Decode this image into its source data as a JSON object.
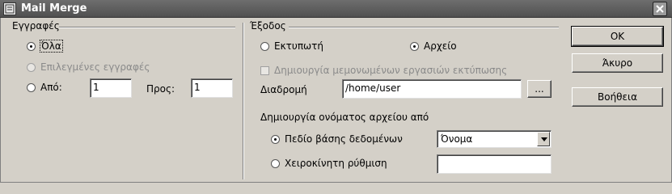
{
  "window": {
    "title": "Mail Merge"
  },
  "records": {
    "group_label": "Εγγραφές",
    "all_label": "Όλα",
    "selected_label": "Επιλεγμένες εγγραφές",
    "from_label": "Από:",
    "from_value": "1",
    "to_label": "Προς:",
    "to_value": "1"
  },
  "output": {
    "group_label": "Έξοδος",
    "printer_label": "Εκτυπωτή",
    "file_label": "Αρχείο",
    "single_jobs_label": "Δημιουργία μεμονωμένων εργασιών εκτύπωσης",
    "path_label": "Διαδρομή",
    "path_value": "/home/user",
    "browse_label": "...",
    "filename_from_label": "Δημιουργία ονόματος αρχείου από",
    "db_field_label": "Πεδίο βάσης δεδομένων",
    "db_field_value": "Όνομα",
    "manual_label": "Χειροκίνητη ρύθμιση",
    "manual_value": ""
  },
  "buttons": {
    "ok": "ΟΚ",
    "cancel": "Άκυρο",
    "help": "Βοήθεια"
  }
}
